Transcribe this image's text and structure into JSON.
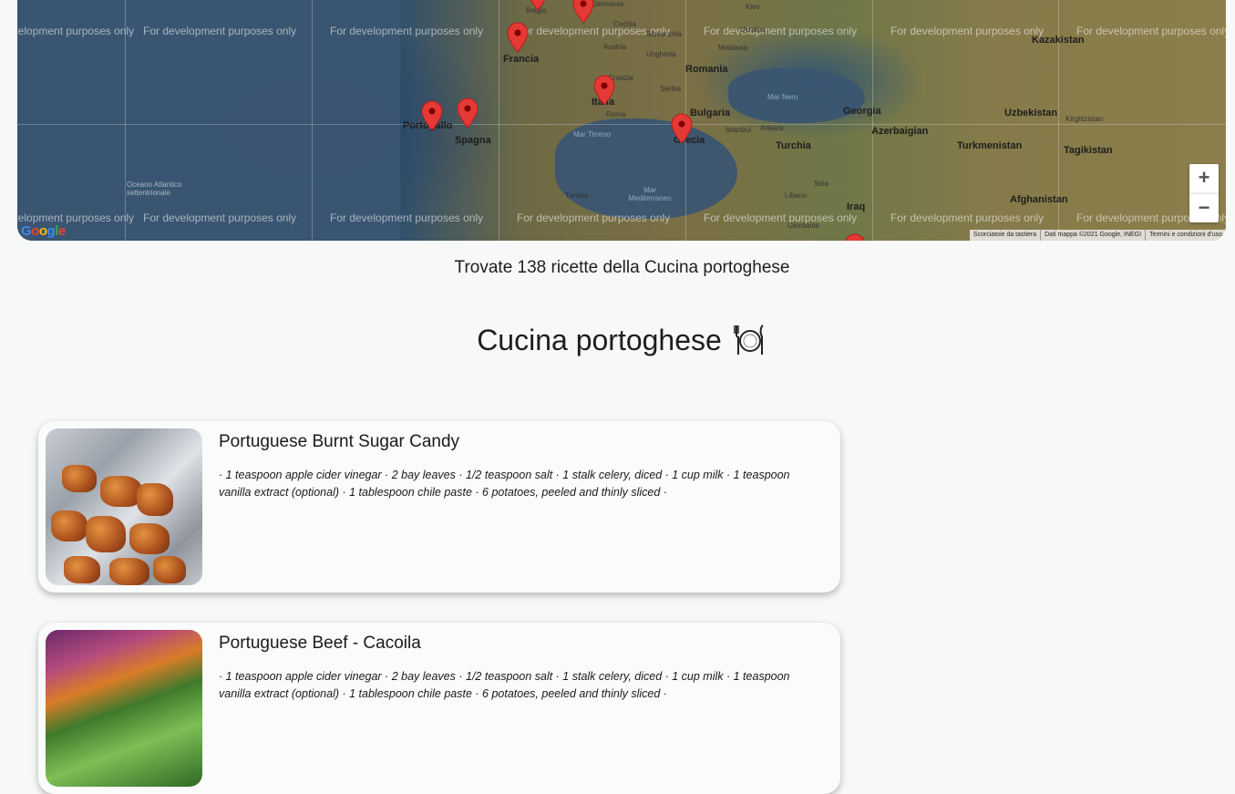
{
  "map": {
    "dev_watermark": "For development purposes only",
    "zoom_in": "+",
    "zoom_out": "−",
    "attribution": {
      "shortcuts": "Scorciatoie da tastiera",
      "data": "Dati mappa ©2021 Google, INEGI",
      "terms": "Termini e condizioni d'uso"
    },
    "logo": "Google",
    "labels": {
      "kazakistan": "Kazakistan",
      "francia": "Francia",
      "romania": "Romania",
      "ungheria": "Ungheria",
      "austria": "Austria",
      "moldavia": "Moldavia",
      "cechia": "Cechia",
      "slovacchia": "Slovacchia",
      "belgio": "Belgio",
      "germania": "Germania",
      "ucraina": "Ucraina",
      "kiev": "Kiev",
      "croazia": "Croazia",
      "serbia": "Serbia",
      "italia": "Italia",
      "roma": "Roma",
      "bulgaria": "Bulgaria",
      "georgia": "Georgia",
      "uzbekistan": "Uzbekistan",
      "kirghizistan": "Kirghizistan",
      "portogallo": "Portogallo",
      "spagna": "Spagna",
      "mar_nero": "Mar Nero",
      "istanbul": "Istanbul",
      "ankara": "Ankara",
      "azerbaigian": "Azerbaigian",
      "turkmenistan": "Turkmenistan",
      "tagikistan": "Tagikistan",
      "grecia": "Grecia",
      "turchia": "Turchia",
      "mar_tirreno": "Mar Tirreno",
      "oceano": "Oceano Atlantico settentrionale",
      "tunisia": "Tunisia",
      "mar_med": "Mar Mediterraneo",
      "siria": "Siria",
      "libano": "Libano",
      "iraq": "Iraq",
      "giordania": "Giordania",
      "afghanistan": "Afghanistan"
    }
  },
  "results_text": "Trovate 138 ricette della Cucina portoghese",
  "page_title": "Cucina portoghese",
  "recipes": [
    {
      "name": "Portuguese Burnt Sugar Candy",
      "ingredients": "· 1 teaspoon apple cider vinegar · 2 bay leaves · 1/2 teaspoon salt · 1 stalk celery, diced · 1 cup milk · 1 teaspoon vanilla extract (optional) · 1 tablespoon chile paste · 6 potatoes, peeled and thinly sliced ·"
    },
    {
      "name": "Portuguese Beef - Cacoila",
      "ingredients": "· 1 teaspoon apple cider vinegar · 2 bay leaves · 1/2 teaspoon salt · 1 stalk celery, diced · 1 cup milk · 1 teaspoon vanilla extract (optional) · 1 tablespoon chile paste · 6 potatoes, peeled and thinly sliced ·"
    }
  ],
  "colors": {
    "pin": "#e53935",
    "background": "#f7f9f9"
  }
}
